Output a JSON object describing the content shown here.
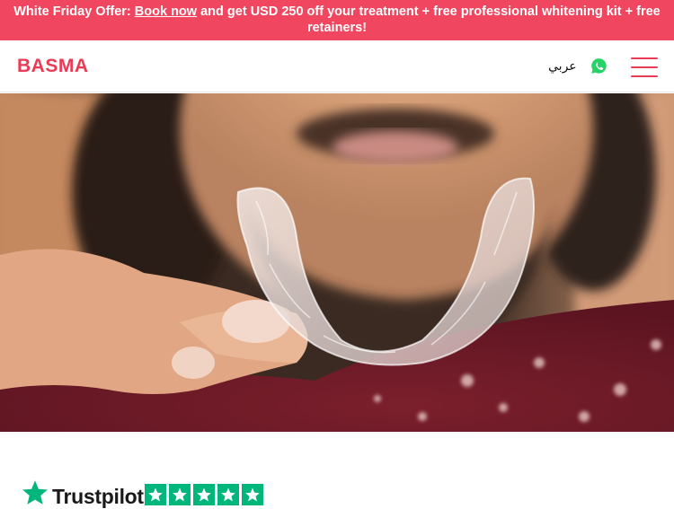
{
  "promo": {
    "prefix": "White Friday Offer: ",
    "link": "Book now",
    "suffix": " and get USD 250 off your treatment + free professional whitening kit + free retainers!"
  },
  "header": {
    "logo": "BASMA",
    "language": "عربي",
    "whatsapp_icon": "whatsapp-icon",
    "menu_icon": "hamburger-menu-icon"
  },
  "hero": {
    "image": "person holding clear aligner"
  },
  "trust": {
    "brand": "Trustpilot",
    "stars": 5,
    "brand_color": "#00b67a"
  },
  "colors": {
    "accent": "#ea3a55",
    "promo_bg": "#f0465f"
  }
}
